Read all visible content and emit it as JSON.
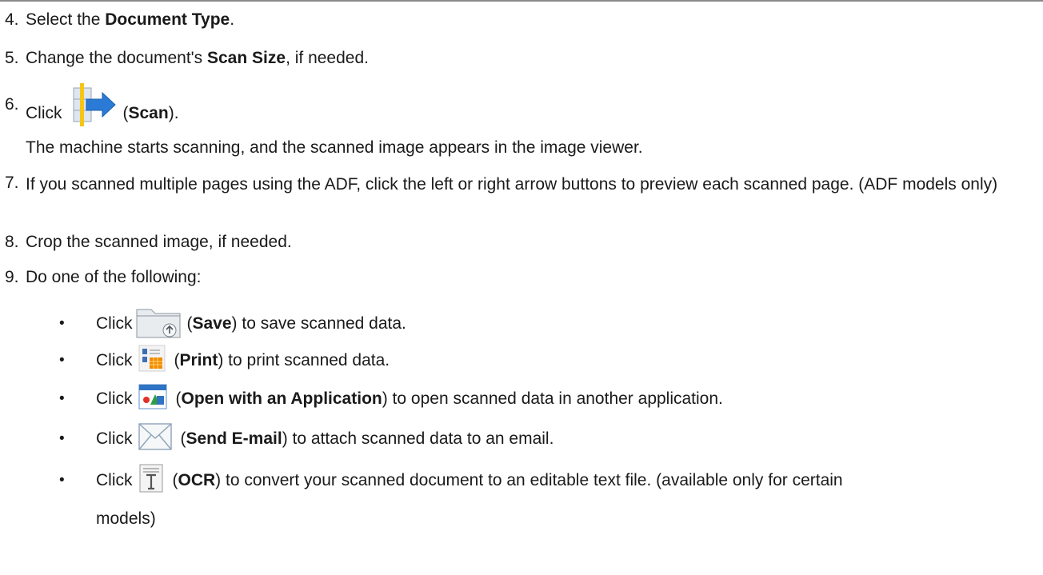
{
  "steps": {
    "s4": {
      "num": "4.",
      "a": "Select the ",
      "b": "Document Type",
      "c": "."
    },
    "s5": {
      "num": "5.",
      "a": "Change the document's ",
      "b": "Scan Size",
      "c": ", if needed."
    },
    "s6": {
      "num": "6.",
      "a": "Click",
      "b": "Scan",
      "note": "The machine starts scanning, and the scanned image appears in the image viewer."
    },
    "s7": {
      "num": "7.",
      "a": "If you scanned multiple pages using the ADF, click the left or right arrow buttons to preview each scanned page. (ADF models only)"
    },
    "s8": {
      "num": "8.",
      "a": "Crop the scanned image, if needed."
    },
    "s9": {
      "num": "9.",
      "a": "Do one of the following:"
    }
  },
  "bullets": {
    "b1": {
      "mark": "•",
      "click": "Click",
      "label": "Save",
      "rest": ") to save scanned data."
    },
    "b2": {
      "mark": "•",
      "click": "Click",
      "label": "Print",
      "rest": ") to print scanned data."
    },
    "b3": {
      "mark": "•",
      "click": "Click",
      "label": "Open with an Application",
      "rest": ") to open scanned data in another application."
    },
    "b4": {
      "mark": "•",
      "click": "Click",
      "label": "Send E-mail",
      "rest": ") to attach scanned data to an email."
    },
    "b5": {
      "mark": "•",
      "click": "Click",
      "label": "OCR",
      "rest": ") to convert your scanned document to an editable text file. (available only for certain",
      "rest2": "models)"
    }
  },
  "icons": {
    "scan": "scan-icon",
    "save": "folder-save-icon",
    "print": "print-icon",
    "app": "open-application-icon",
    "mail": "envelope-icon",
    "ocr": "ocr-text-icon"
  }
}
